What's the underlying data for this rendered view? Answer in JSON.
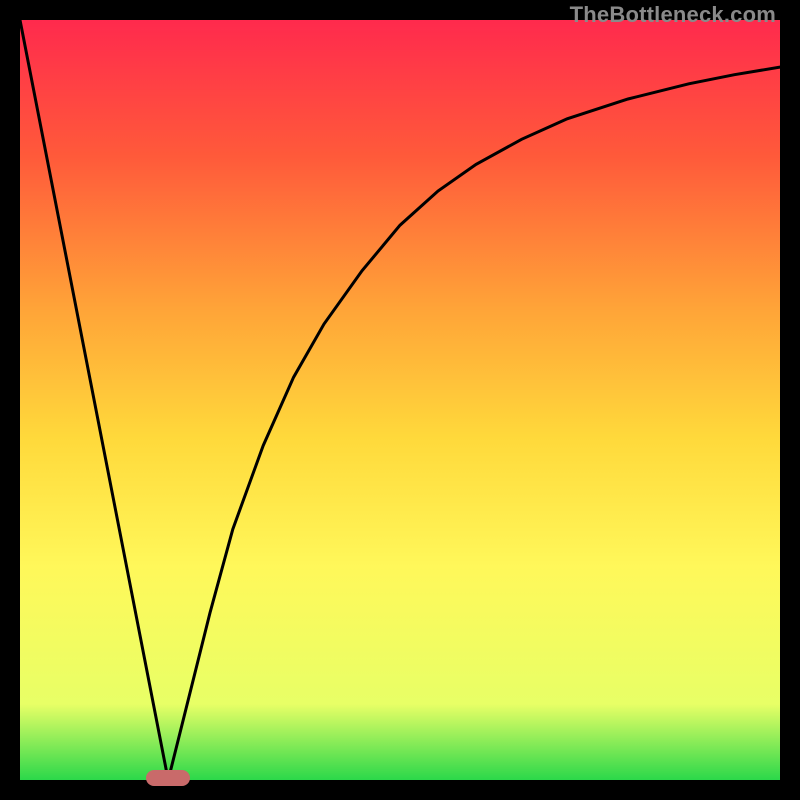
{
  "watermark": "TheBottleneck.com",
  "colors": {
    "bg": "#000000",
    "grad_top": "#ff2a4d",
    "grad_mid1": "#ff5a3a",
    "grad_mid2": "#ffa438",
    "grad_mid3": "#ffd93b",
    "grad_mid4": "#fff85a",
    "grad_mid5": "#e8ff66",
    "grad_bottom": "#2bd84a",
    "curve": "#000000",
    "marker": "#c96a6a"
  },
  "chart_data": {
    "type": "line",
    "title": "",
    "xlabel": "",
    "ylabel": "",
    "xlim": [
      0,
      100
    ],
    "ylim": [
      0,
      100
    ],
    "series": [
      {
        "name": "left-slope",
        "x": [
          0,
          19.5
        ],
        "y": [
          100,
          0
        ]
      },
      {
        "name": "right-curve",
        "x": [
          19.5,
          22,
          25,
          28,
          32,
          36,
          40,
          45,
          50,
          55,
          60,
          66,
          72,
          80,
          88,
          94,
          100
        ],
        "y": [
          0,
          10,
          22,
          33,
          44,
          53,
          60,
          67,
          73,
          77.5,
          81,
          84.3,
          87,
          89.6,
          91.6,
          92.8,
          93.8
        ]
      }
    ],
    "annotations": [
      {
        "name": "min-marker",
        "x": 19.5,
        "y": 0,
        "shape": "rounded-rect",
        "color": "#c96a6a"
      }
    ],
    "background": "vertical-gradient-red-to-green"
  }
}
